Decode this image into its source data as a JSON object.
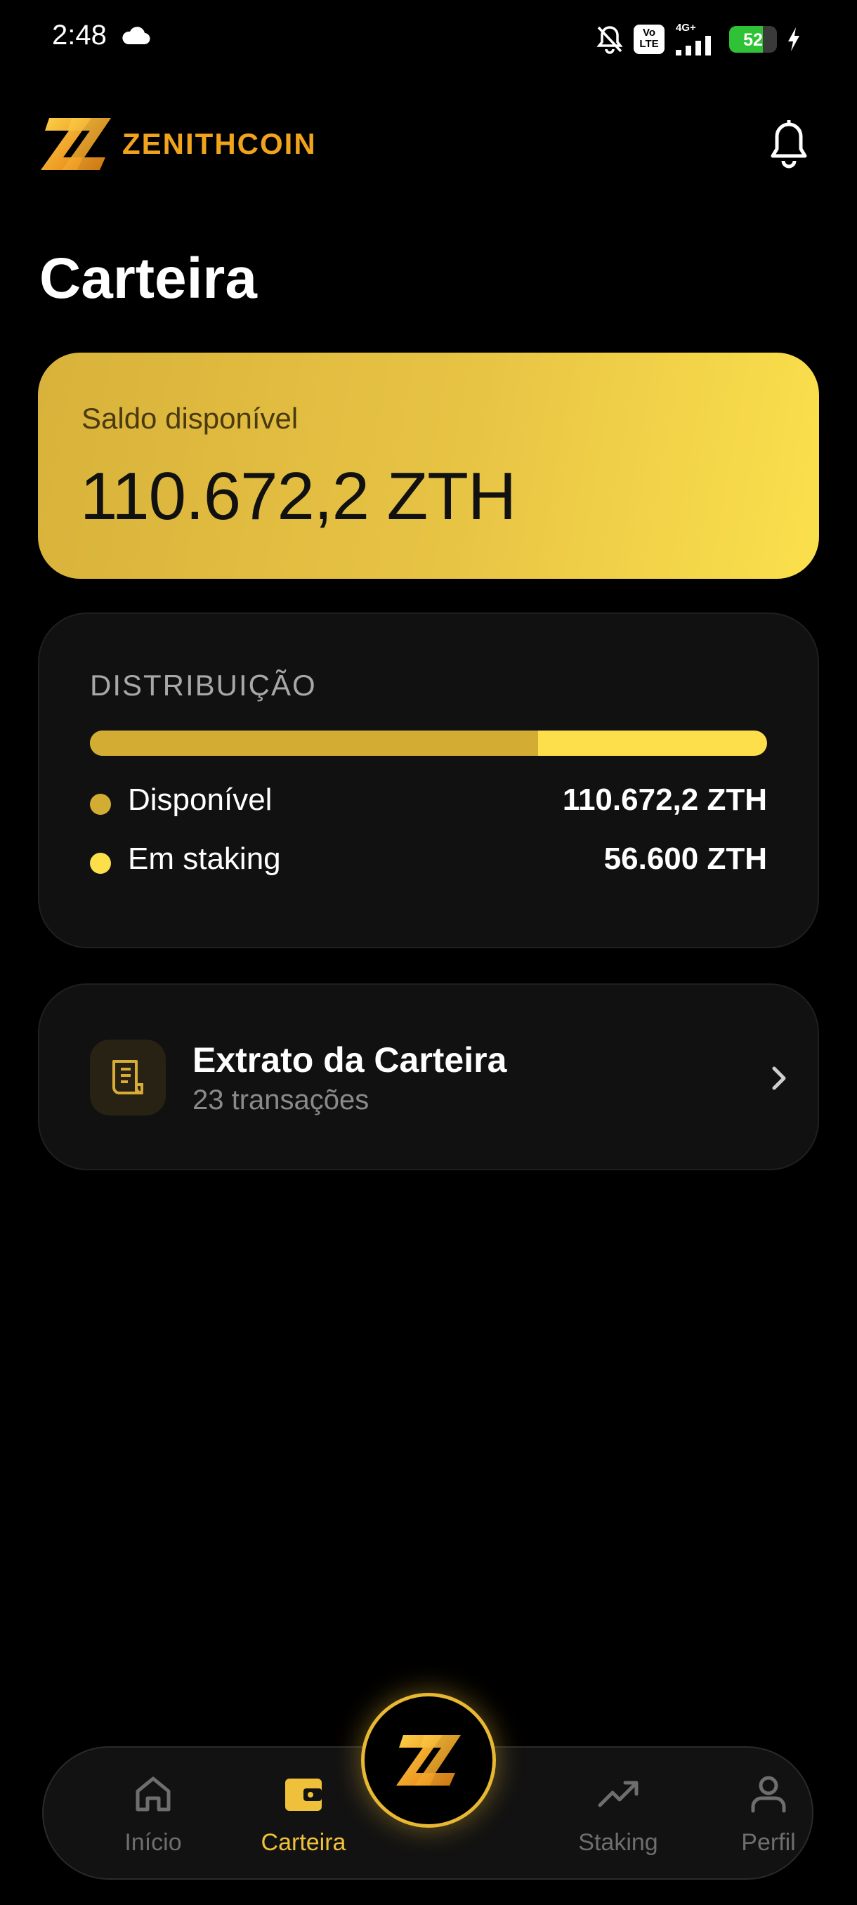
{
  "status_bar": {
    "time": "2:48",
    "volte": "Vo\nLTE",
    "network": "4G+",
    "battery": "52"
  },
  "header": {
    "brand": "ZENITHCOIN"
  },
  "page": {
    "title": "Carteira"
  },
  "balance": {
    "label": "Saldo disponível",
    "value": "110.672,2 ZTH"
  },
  "distribution": {
    "title": "DISTRIBUIÇÃO",
    "available_fraction": 0.662,
    "items": [
      {
        "label": "Disponível",
        "value": "110.672,2 ZTH",
        "color": "#d3ac34"
      },
      {
        "label": "Em staking",
        "value": "56.600 ZTH",
        "color": "#fddf4b"
      }
    ]
  },
  "statement": {
    "title": "Extrato da Carteira",
    "subtitle": "23 transações"
  },
  "nav": {
    "items": [
      {
        "label": "Início",
        "icon": "home-icon",
        "active": false
      },
      {
        "label": "Carteira",
        "icon": "wallet-icon",
        "active": true
      },
      {
        "label": "Staking",
        "icon": "trending-up-icon",
        "active": false
      },
      {
        "label": "Perfil",
        "icon": "user-icon",
        "active": false
      }
    ]
  },
  "colors": {
    "accent": "#efc13a",
    "background": "#000000",
    "card": "#111111"
  }
}
